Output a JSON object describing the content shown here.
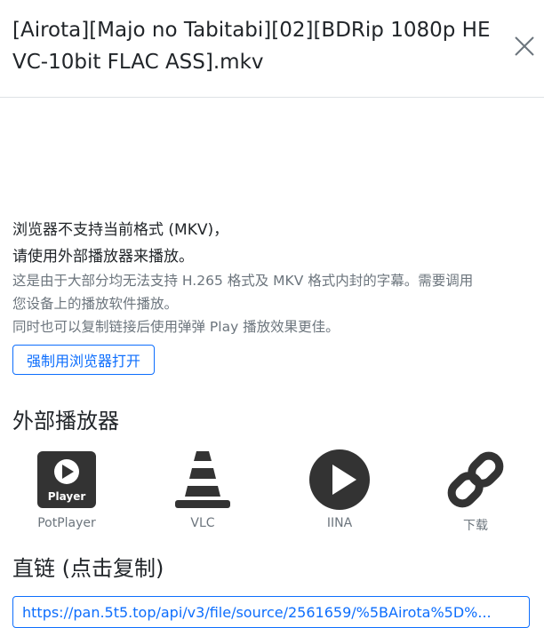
{
  "modal": {
    "title": "[Airota][Majo no Tabitabi][02][BDRip 1080p HEVC-10bit FLAC ASS].mkv",
    "close_icon": "close-icon"
  },
  "notice": {
    "line1": "浏览器不支持当前格式 (MKV)，",
    "line2": "请使用外部播放器来播放。",
    "detail1": "这是由于大部分均无法支持 H.265 格式及 MKV 格式内封的字幕。需要调用",
    "detail2": "您设备上的播放软件播放。",
    "detail3": "同时也可以复制链接后使用弹弹 Play 播放效果更佳。"
  },
  "force_button": {
    "label": "强制用浏览器打开"
  },
  "external_players": {
    "title": "外部播放器",
    "items": [
      {
        "label": "PotPlayer",
        "icon": "potplayer-icon",
        "badge": "Player"
      },
      {
        "label": "VLC",
        "icon": "vlc-cone-icon"
      },
      {
        "label": "IINA",
        "icon": "iina-play-icon"
      },
      {
        "label": "下载",
        "icon": "link-icon"
      }
    ]
  },
  "direct_link": {
    "title": "直链 (点击复制)",
    "value": "https://pan.5t5.top/api/v3/file/source/2561659/%5BAirota%5D%..."
  },
  "colors": {
    "accent": "#0d6efd",
    "muted": "#6c757d",
    "text": "#212529",
    "icon": "#333333"
  }
}
